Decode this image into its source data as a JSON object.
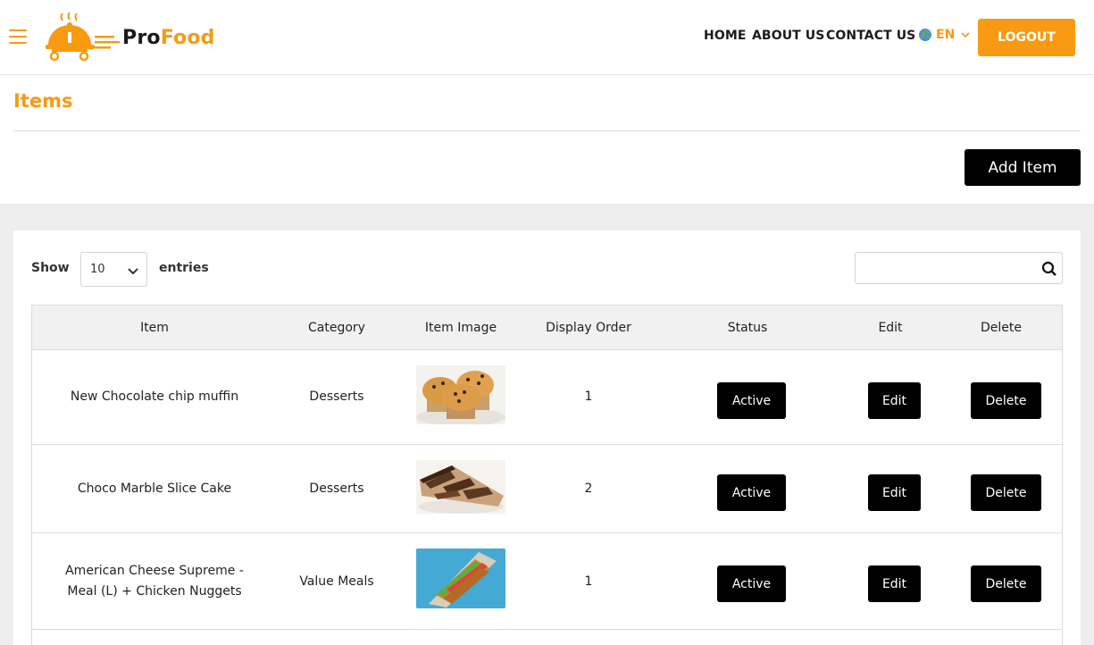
{
  "header": {
    "logo_pro": "Pro",
    "logo_food": "Food",
    "nav": {
      "home": "HOME",
      "about": "ABOUT US",
      "contact": "CONTACT US"
    },
    "language": "EN",
    "logout": "LOGOUT"
  },
  "page": {
    "title": "Items",
    "add_button": "Add Item"
  },
  "controls": {
    "show_label": "Show",
    "entries_value": "10",
    "entries_label": "entries",
    "search_value": "",
    "search_placeholder": ""
  },
  "table": {
    "headers": [
      "Item",
      "Category",
      "Item Image",
      "Display Order",
      "Status",
      "Edit",
      "Delete"
    ],
    "rows": [
      {
        "item": "New Chocolate chip muffin",
        "item_line2": "",
        "category": "Desserts",
        "image": "muffin-image",
        "order": "1",
        "status": "Active",
        "edit": "Edit",
        "delete": "Delete"
      },
      {
        "item": "Choco Marble Slice Cake",
        "item_line2": "",
        "category": "Desserts",
        "image": "cake-image",
        "order": "2",
        "status": "Active",
        "edit": "Edit",
        "delete": "Delete"
      },
      {
        "item": "American Cheese Supreme -",
        "item_line2": "Meal (L) + Chicken Nuggets",
        "category": "Value Meals",
        "image": "sandwich-image",
        "order": "1",
        "status": "Active",
        "edit": "Edit",
        "delete": "Delete"
      }
    ]
  },
  "colors": {
    "accent": "#f89a12",
    "button_dark": "#000000",
    "page_bg": "#eeeeee"
  }
}
